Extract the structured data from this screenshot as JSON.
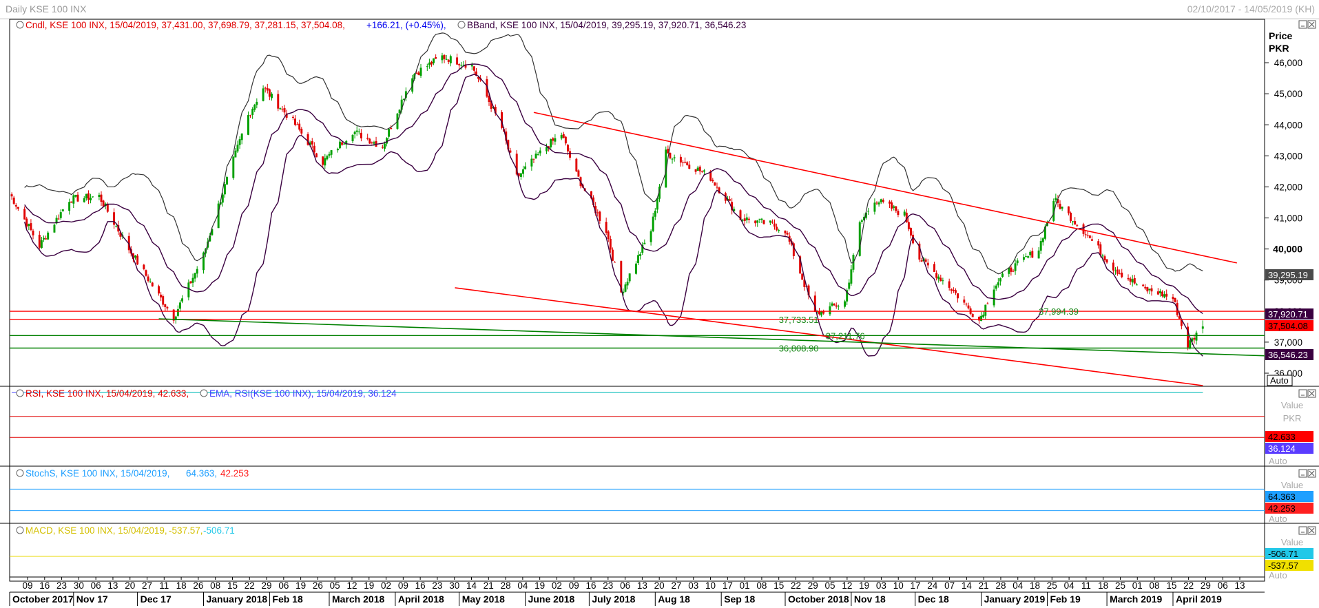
{
  "window": {
    "title": "Daily KSE 100 INX",
    "date_range": "02/10/2017 - 14/05/2019 (KH)"
  },
  "price_panel": {
    "legend_cndl": "Cndl, KSE 100 INX, 15/04/2019, 37,431.00, 37,698.79, 37,281.15, 37,504.08,",
    "legend_change": "+166.21, (+0.45%),",
    "legend_bband": "BBand, KSE 100 INX, 15/04/2019, 39,295.19, 37,920.71, 36,546.23",
    "axis_title_1": "Price",
    "axis_title_2": "PKR",
    "ticks": [
      "46,000",
      "45,000",
      "44,000",
      "43,000",
      "42,000",
      "41,000",
      "40,000",
      "39,000",
      "38,000",
      "37,000",
      "36,000"
    ],
    "badges": {
      "upper": "39,295.19",
      "middle": "37,920.71",
      "close": "37,504.08",
      "lower": "36,546.23"
    },
    "auto_label": "Auto",
    "annotations": [
      "37,733.51",
      "37,211.76",
      "36,808.90",
      "37,994.39"
    ]
  },
  "rsi_panel": {
    "legend_rsi": "RSI, KSE 100 INX, 15/04/2019, 42.633,",
    "legend_ema": "EMA, RSI(KSE 100 INX), 15/04/2019, 36.124",
    "axis_title_1": "Value",
    "axis_title_2": "PKR",
    "badges": {
      "rsi": "42.633",
      "ema": "36.124"
    },
    "auto_label": "Auto"
  },
  "stoch_panel": {
    "legend_name": "StochS, KSE 100 INX, 15/04/2019,",
    "legend_k": "64.363,",
    "legend_d": "42.253",
    "axis_title": "Value",
    "badges": {
      "k": "64.363",
      "d": "42.253"
    },
    "auto_label": "Auto"
  },
  "macd_panel": {
    "legend_name": "MACD, KSE 100 INX, 15/04/2019,",
    "legend_macd": "-537.57,",
    "legend_signal": "-506.71",
    "axis_title": "Value",
    "badges": {
      "signal": "-506.71",
      "macd": "-537.57"
    },
    "auto_label": "Auto"
  },
  "time_axis": {
    "day_ticks": [
      "09",
      "16",
      "23",
      "30",
      "06",
      "13",
      "20",
      "27",
      "11",
      "18",
      "26",
      "08",
      "15",
      "22",
      "29",
      "06",
      "19",
      "26",
      "05",
      "12",
      "19",
      "02",
      "09",
      "16",
      "23",
      "30",
      "14",
      "21",
      "28",
      "04",
      "19",
      "02",
      "09",
      "16",
      "23",
      "06",
      "13",
      "20",
      "27",
      "03",
      "10",
      "17",
      "01",
      "08",
      "15",
      "22",
      "29",
      "05",
      "12",
      "19",
      "03",
      "10",
      "17",
      "24",
      "07",
      "14",
      "21",
      "28",
      "04",
      "18",
      "25",
      "04",
      "11",
      "18",
      "25",
      "01",
      "08",
      "15",
      "22",
      "29",
      "06",
      "13"
    ],
    "months": [
      "October 2017",
      "Nov 17",
      "Dec 17",
      "January 2018",
      "Feb 18",
      "March 2018",
      "April 2018",
      "May 2018",
      "June 2018",
      "July 2018",
      "Aug 18",
      "Sep 18",
      "October 2018",
      "Nov 18",
      "Dec 18",
      "January 2019",
      "Feb 19",
      "March 2019",
      "April 2019"
    ]
  },
  "colors": {
    "up": "#00a000",
    "down": "#e00000",
    "band": "#3a0040",
    "resistance": "#ff0000",
    "support": "#008000",
    "rsi": "#ff0000",
    "ema": "#4040ff",
    "stoch_k": "#1e9fff",
    "stoch_d": "#ff2020",
    "macd": "#f0e000",
    "signal": "#22c8e8"
  },
  "chart_data": {
    "type": "candlestick",
    "title": "Daily KSE 100 INX",
    "period": {
      "start": "2017-10-02",
      "end": "2019-04-15",
      "view_end": "2019-05-14"
    },
    "ylim": [
      35600,
      47000
    ],
    "unit": "PKR",
    "last_candle": {
      "date": "2019-04-15",
      "open": 37431.0,
      "high": 37698.79,
      "low": 37281.15,
      "close": 37504.08,
      "change": 166.21,
      "change_pct": 0.45
    },
    "close_anchors": [
      [
        "2017-10-02",
        41800
      ],
      [
        "2017-10-16",
        40100
      ],
      [
        "2017-10-30",
        41600
      ],
      [
        "2017-11-13",
        41700
      ],
      [
        "2017-11-27",
        40000
      ],
      [
        "2017-12-11",
        38500
      ],
      [
        "2017-12-18",
        37800
      ],
      [
        "2018-01-01",
        39800
      ],
      [
        "2018-01-08",
        41400
      ],
      [
        "2018-01-22",
        44300
      ],
      [
        "2018-01-29",
        45200
      ],
      [
        "2018-02-12",
        44100
      ],
      [
        "2018-02-26",
        42800
      ],
      [
        "2018-03-12",
        43800
      ],
      [
        "2018-03-26",
        43300
      ],
      [
        "2018-04-09",
        45600
      ],
      [
        "2018-04-23",
        46200
      ],
      [
        "2018-05-07",
        45900
      ],
      [
        "2018-05-21",
        43900
      ],
      [
        "2018-05-28",
        42300
      ],
      [
        "2018-06-11",
        43300
      ],
      [
        "2018-06-18",
        43700
      ],
      [
        "2018-06-25",
        42400
      ],
      [
        "2018-07-09",
        40600
      ],
      [
        "2018-07-16",
        38600
      ],
      [
        "2018-07-30",
        40600
      ],
      [
        "2018-08-06",
        43100
      ],
      [
        "2018-08-20",
        42600
      ],
      [
        "2018-08-27",
        42300
      ],
      [
        "2018-09-10",
        41000
      ],
      [
        "2018-09-24",
        40800
      ],
      [
        "2018-10-01",
        40600
      ],
      [
        "2018-10-15",
        37900
      ],
      [
        "2018-10-29",
        38300
      ],
      [
        "2018-11-05",
        40800
      ],
      [
        "2018-11-12",
        41600
      ],
      [
        "2018-11-26",
        41100
      ],
      [
        "2018-12-03",
        39700
      ],
      [
        "2018-12-17",
        38800
      ],
      [
        "2018-12-31",
        37700
      ],
      [
        "2019-01-07",
        38800
      ],
      [
        "2019-01-14",
        39300
      ],
      [
        "2019-01-28",
        40000
      ],
      [
        "2019-02-04",
        41600
      ],
      [
        "2019-02-18",
        40600
      ],
      [
        "2019-03-04",
        39400
      ],
      [
        "2019-03-18",
        38700
      ],
      [
        "2019-03-25",
        38600
      ],
      [
        "2019-04-01",
        38400
      ],
      [
        "2019-04-08",
        36900
      ],
      [
        "2019-04-15",
        37504
      ]
    ],
    "bollinger_last": {
      "upper": 39295.19,
      "middle": 37920.71,
      "lower": 36546.23
    },
    "horizontal_levels": [
      {
        "value": 37994.39,
        "color": "red"
      },
      {
        "value": 37733.51,
        "color": "red"
      },
      {
        "value": 37211.76,
        "color": "green"
      },
      {
        "value": 36808.9,
        "color": "green"
      }
    ],
    "trendlines": [
      {
        "from": [
          "2018-06-05",
          44400
        ],
        "to": [
          "2019-05-01",
          39550
        ],
        "color": "red"
      },
      {
        "from": [
          "2018-04-29",
          38750
        ],
        "to": [
          "2019-04-15",
          35600
        ],
        "color": "red"
      },
      {
        "from": [
          "2017-12-11",
          37750
        ],
        "to": [
          "2019-05-14",
          36560
        ],
        "color": "green"
      }
    ],
    "rsi": {
      "last": 42.633,
      "ema_last": 36.124,
      "bands": [
        70,
        30
      ]
    },
    "stochastic": {
      "k_last": 64.363,
      "d_last": 42.253,
      "bands": [
        80,
        20
      ]
    },
    "macd": {
      "macd_last": -537.57,
      "signal_last": -506.71
    }
  }
}
